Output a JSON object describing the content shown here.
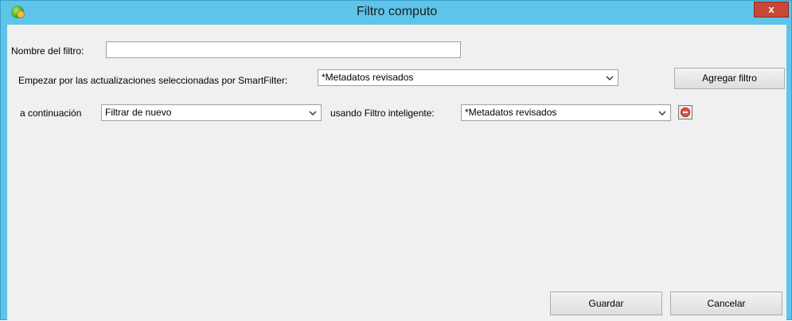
{
  "window": {
    "title": "Filtro computo",
    "close_glyph": "x"
  },
  "form": {
    "name_label": "Nombre del filtro:",
    "name_value": "",
    "start_label": "Empezar por las actualizaciones seleccionadas por SmartFilter:",
    "start_value": "*Metadatos revisados",
    "add_filter_label": "Agregar filtro",
    "then_label": "a continuación",
    "then_value": "Filtrar de nuevo",
    "using_label": "usando Filtro inteligente:",
    "using_value": "*Metadatos revisados"
  },
  "footer": {
    "save_label": "Guardar",
    "cancel_label": "Cancelar"
  },
  "icons": {
    "app": "app-globe-icon",
    "close": "close-icon",
    "dropdown": "chevron-down-icon",
    "remove": "remove-filter-icon"
  },
  "colors": {
    "titlebar": "#5ec4ea",
    "close": "#c94737",
    "remove": "#e5533d",
    "client": "#f0f0f0"
  }
}
